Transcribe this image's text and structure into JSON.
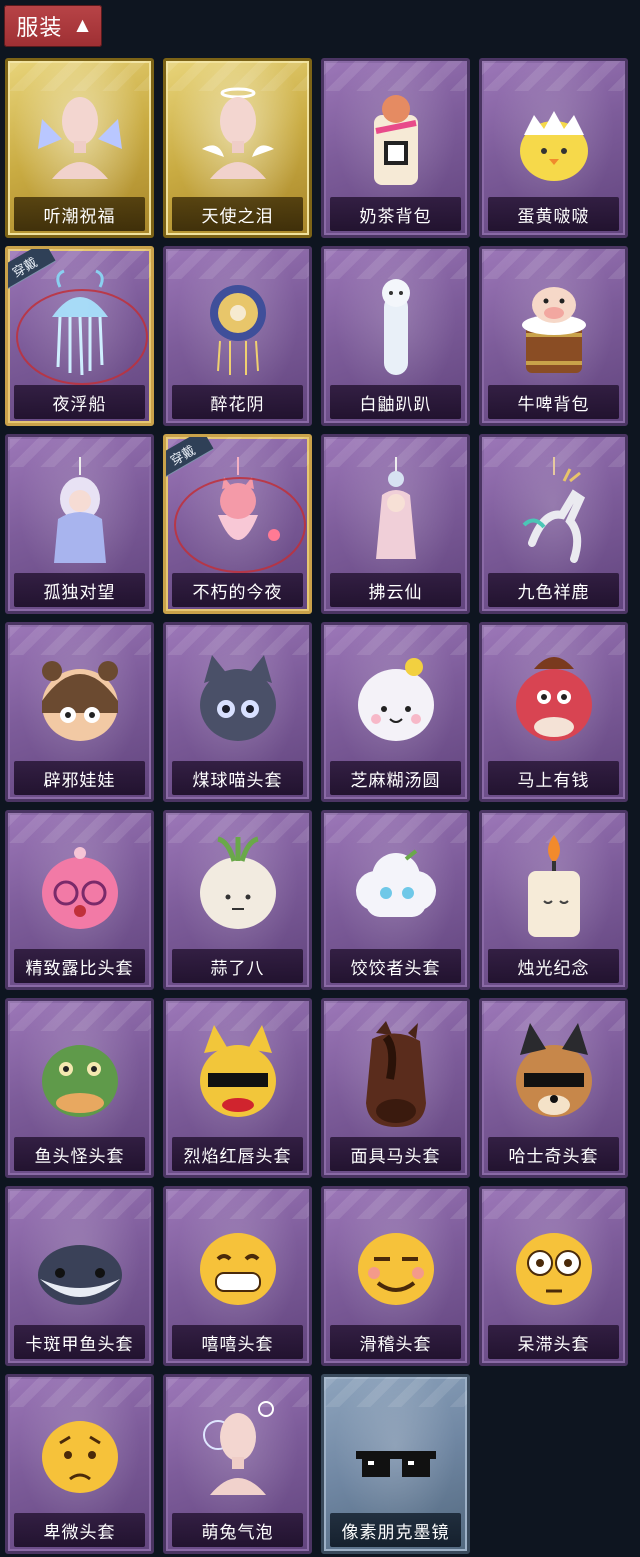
{
  "header": {
    "title": "服装"
  },
  "worn_badge": "穿戴",
  "items": [
    {
      "name": "听潮祝福",
      "icon": "mannequin-ice-wings-icon",
      "tier": "gold",
      "worn": false
    },
    {
      "name": "天使之泪",
      "icon": "mannequin-angel-icon",
      "tier": "gold",
      "worn": false
    },
    {
      "name": "奶茶背包",
      "icon": "milk-tea-backpack-icon",
      "tier": "purple",
      "worn": false
    },
    {
      "name": "蛋黄啵啵",
      "icon": "egg-chick-icon",
      "tier": "purple",
      "worn": false
    },
    {
      "name": "夜浮船",
      "icon": "jellyfish-icon",
      "tier": "purple",
      "worn": true
    },
    {
      "name": "醉花阴",
      "icon": "flower-dreamcatcher-icon",
      "tier": "purple",
      "worn": false
    },
    {
      "name": "白鼬趴趴",
      "icon": "white-ferret-icon",
      "tier": "purple",
      "worn": false
    },
    {
      "name": "牛啤背包",
      "icon": "cow-beer-mug-icon",
      "tier": "purple",
      "worn": false
    },
    {
      "name": "孤独对望",
      "icon": "doll-charm-icon",
      "tier": "purple",
      "worn": false
    },
    {
      "name": "不朽的今夜",
      "icon": "fox-bowl-charm-icon",
      "tier": "purple",
      "worn": true
    },
    {
      "name": "拂云仙",
      "icon": "fairy-charm-icon",
      "tier": "purple",
      "worn": false
    },
    {
      "name": "九色祥鹿",
      "icon": "deer-charm-icon",
      "tier": "purple",
      "worn": false
    },
    {
      "name": "辟邪娃娃",
      "icon": "doll-head-icon",
      "tier": "purple",
      "worn": false
    },
    {
      "name": "煤球喵头套",
      "icon": "black-cat-head-icon",
      "tier": "purple",
      "worn": false
    },
    {
      "name": "芝麻糊汤圆",
      "icon": "tangyuan-head-icon",
      "tier": "purple",
      "worn": false
    },
    {
      "name": "马上有钱",
      "icon": "red-horse-head-icon",
      "tier": "purple",
      "worn": false
    },
    {
      "name": "精致露比头套",
      "icon": "pink-beaver-head-icon",
      "tier": "purple",
      "worn": false
    },
    {
      "name": "蒜了八",
      "icon": "garlic-head-icon",
      "tier": "purple",
      "worn": false
    },
    {
      "name": "饺饺者头套",
      "icon": "cloud-dumpling-head-icon",
      "tier": "purple",
      "worn": false
    },
    {
      "name": "烛光纪念",
      "icon": "candle-head-icon",
      "tier": "purple",
      "worn": false
    },
    {
      "name": "鱼头怪头套",
      "icon": "fish-head-icon",
      "tier": "purple",
      "worn": false
    },
    {
      "name": "烈焰红唇头套",
      "icon": "yellow-lips-head-icon",
      "tier": "purple",
      "worn": false
    },
    {
      "name": "面具马头套",
      "icon": "horse-mask-icon",
      "tier": "purple",
      "worn": false
    },
    {
      "name": "哈士奇头套",
      "icon": "husky-head-icon",
      "tier": "purple",
      "worn": false
    },
    {
      "name": "卡斑甲鱼头套",
      "icon": "whale-head-icon",
      "tier": "purple",
      "worn": false
    },
    {
      "name": "嘻嘻头套",
      "icon": "grin-emoji-head-icon",
      "tier": "purple",
      "worn": false
    },
    {
      "name": "滑稽头套",
      "icon": "smirk-emoji-head-icon",
      "tier": "purple",
      "worn": false
    },
    {
      "name": "呆滞头套",
      "icon": "stare-emoji-head-icon",
      "tier": "purple",
      "worn": false
    },
    {
      "name": "卑微头套",
      "icon": "humble-emoji-head-icon",
      "tier": "purple",
      "worn": false
    },
    {
      "name": "萌兔气泡",
      "icon": "mannequin-bubble-icon",
      "tier": "purple",
      "worn": false
    },
    {
      "name": "像素朋克墨镜",
      "icon": "pixel-sunglasses-icon",
      "tier": "blue",
      "worn": false
    }
  ],
  "colors": {
    "purple": "#7d5c9a",
    "gold": "#c9ab42",
    "blue": "#6f86a2",
    "header": "#b84447",
    "background": "#0e1520"
  }
}
